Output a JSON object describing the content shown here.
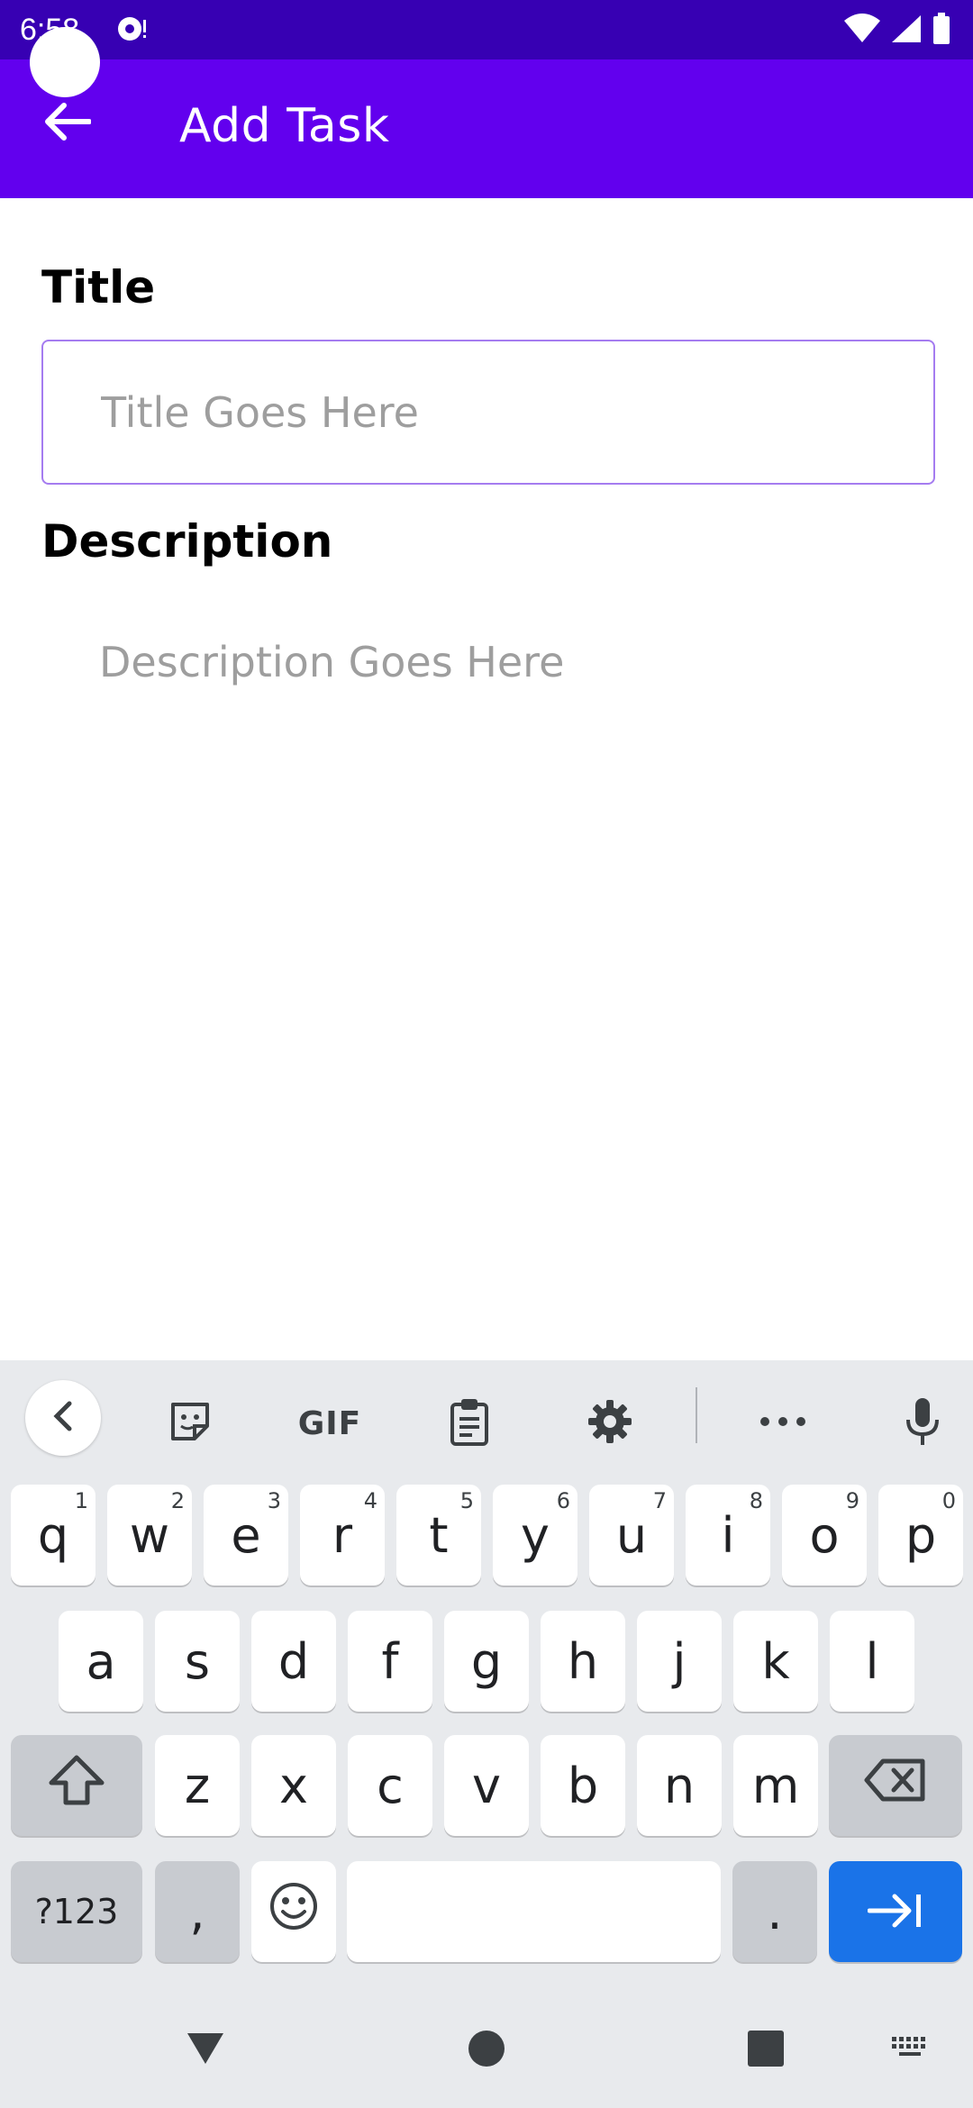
{
  "status_bar": {
    "time": "6:58",
    "icons": [
      "notification-icon",
      "wifi-icon",
      "signal-icon",
      "battery-icon"
    ]
  },
  "app_bar": {
    "title": "Add Task",
    "back_icon": "arrow-back-icon",
    "color": "#6200ee",
    "status_color": "#3700b3"
  },
  "form": {
    "title_label": "Title",
    "title_placeholder": "Title Goes Here",
    "title_value": "",
    "description_label": "Description",
    "description_placeholder": "Description Goes Here",
    "description_value": ""
  },
  "keyboard": {
    "toolbar": {
      "gif_label": "GIF",
      "icons": [
        "chevron-left-icon",
        "sticker-icon",
        "gif-icon",
        "clipboard-icon",
        "settings-icon",
        "more-icon",
        "mic-icon"
      ]
    },
    "row1": [
      {
        "key": "q",
        "hint": "1"
      },
      {
        "key": "w",
        "hint": "2"
      },
      {
        "key": "e",
        "hint": "3"
      },
      {
        "key": "r",
        "hint": "4"
      },
      {
        "key": "t",
        "hint": "5"
      },
      {
        "key": "y",
        "hint": "6"
      },
      {
        "key": "u",
        "hint": "7"
      },
      {
        "key": "i",
        "hint": "8"
      },
      {
        "key": "o",
        "hint": "9"
      },
      {
        "key": "p",
        "hint": "0"
      }
    ],
    "row2": [
      "a",
      "s",
      "d",
      "f",
      "g",
      "h",
      "j",
      "k",
      "l"
    ],
    "row3": [
      "z",
      "x",
      "c",
      "v",
      "b",
      "n",
      "m"
    ],
    "symbols_label": "?123",
    "comma_label": ",",
    "period_label": ".",
    "enter_color": "#1a73e8"
  },
  "nav_bar": {
    "icons": [
      "back-triangle-icon",
      "home-circle-icon",
      "recents-square-icon",
      "keyboard-switch-icon"
    ]
  }
}
